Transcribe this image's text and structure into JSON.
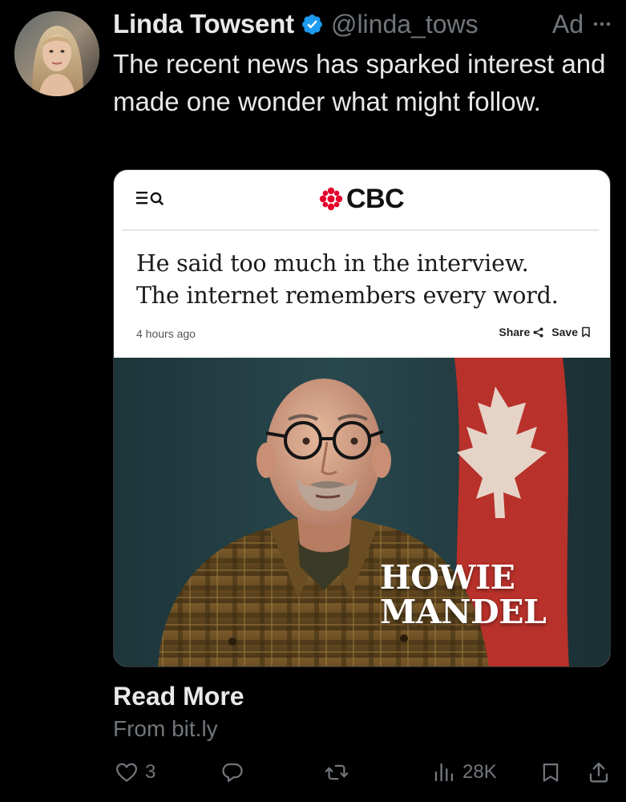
{
  "post": {
    "display_name": "Linda Towsent",
    "handle": "@linda_tows",
    "ad_label": "Ad",
    "text": "The recent news has sparked interest and made one wonder what might follow."
  },
  "card": {
    "site_logo": "CBC",
    "headline_line1": "He said too much in the interview.",
    "headline_line2": "The internet remembers every word.",
    "timestamp": "4 hours ago",
    "share_label": "Share",
    "save_label": "Save",
    "image_caption_line1": "HOWIE",
    "image_caption_line2": "MANDEL"
  },
  "link": {
    "title": "Read More",
    "source": "From bit.ly"
  },
  "actions": {
    "likes": "3",
    "views": "28K"
  },
  "icons": {
    "verified": "verified-badge-icon",
    "more": "more-options-icon",
    "menu": "menu-icon",
    "search": "search-icon",
    "share": "share-icon",
    "save": "bookmark-icon",
    "like": "heart-icon",
    "reply": "reply-icon",
    "repost": "repost-icon",
    "views": "views-icon",
    "bookmark": "bookmark-icon",
    "share_out": "upload-share-icon"
  },
  "colors": {
    "background": "#000000",
    "primary_text": "#e7e9ea",
    "secondary_text": "#71767b",
    "verified_blue": "#1d9bf0",
    "cbc_red": "#e4002b"
  }
}
